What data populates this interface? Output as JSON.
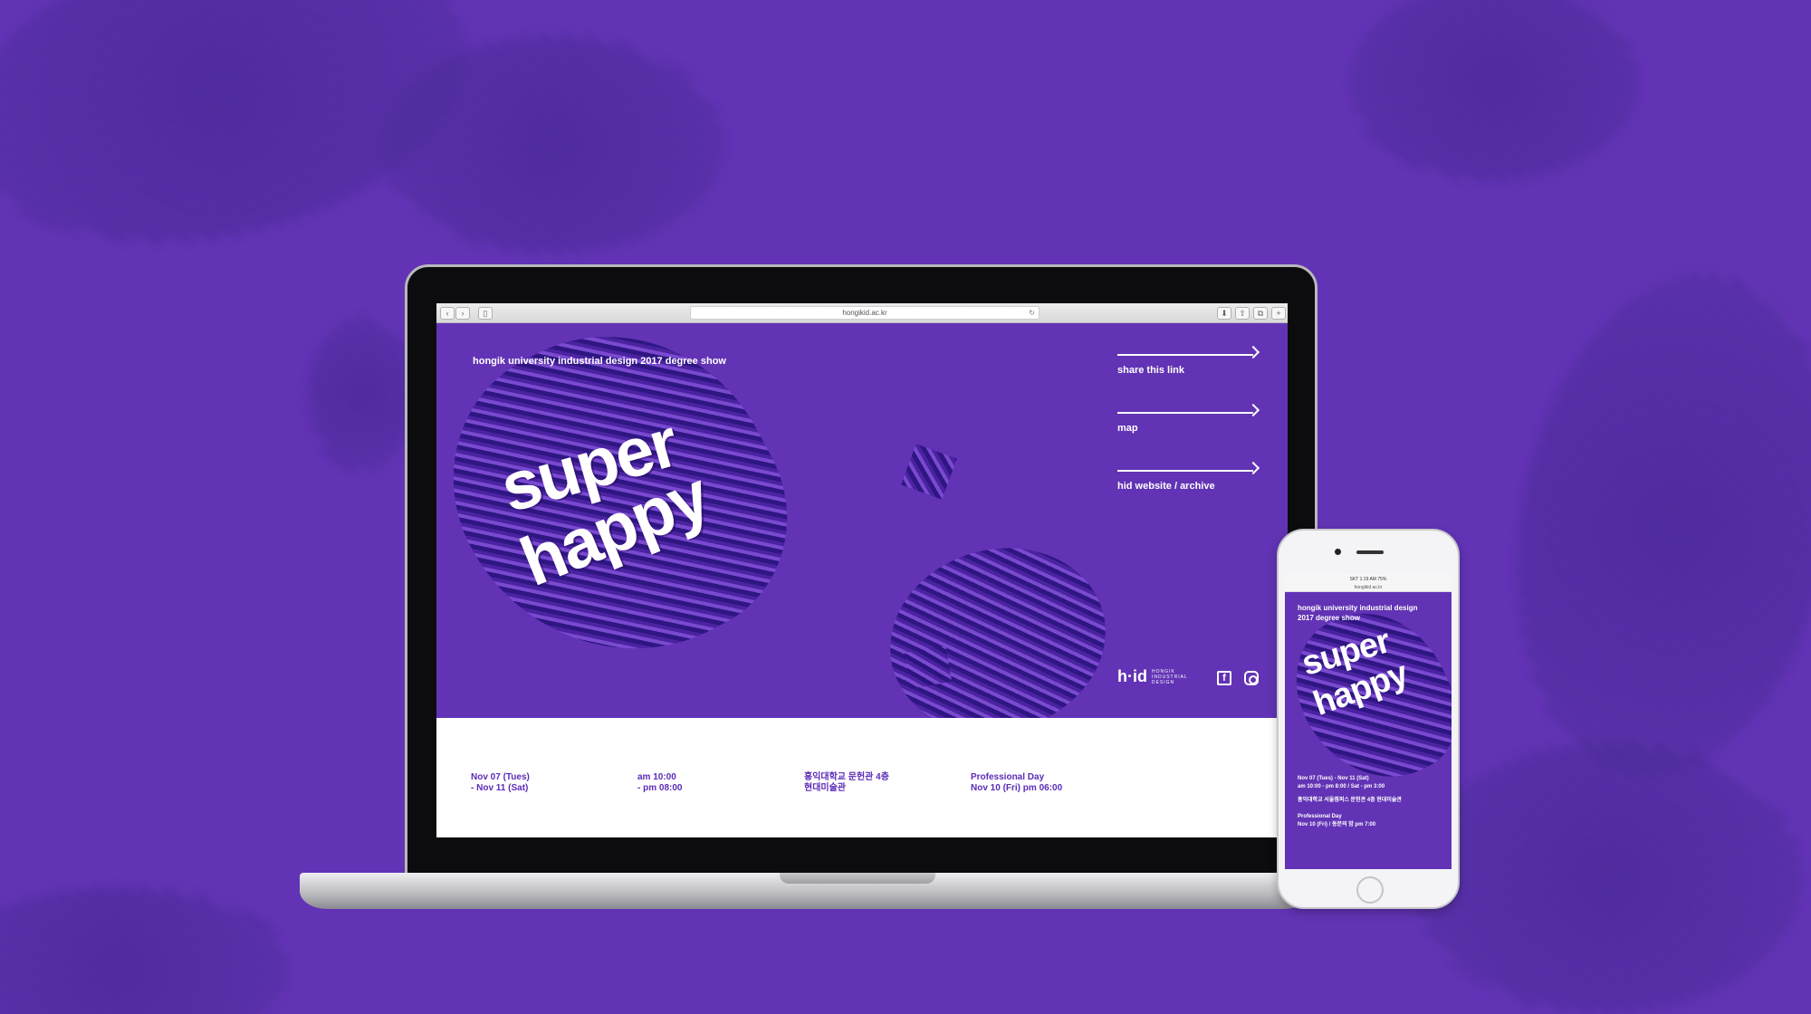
{
  "browser": {
    "url": "hongikid.ac.kr",
    "back_icon": "chevron-left-icon",
    "forward_icon": "chevron-right-icon",
    "sidebar_icon": "sidebar-icon",
    "reload_icon": "reload-icon",
    "download_icon": "download-icon",
    "share_icon": "share-icon",
    "tabs_icon": "tabs-icon",
    "new_tab_icon": "plus-icon",
    "back_glyph": "‹",
    "forward_glyph": "›",
    "sidebar_glyph": "▯",
    "reload_glyph": "↻",
    "download_glyph": "⬇",
    "share_glyph": "⇧",
    "tabs_glyph": "⧉",
    "new_tab_glyph": "+"
  },
  "hero": {
    "title": "hongik university industrial design 2017 degree show",
    "word_super": "super",
    "word_happy": "happy"
  },
  "links": [
    {
      "label": "share this link"
    },
    {
      "label": "map"
    },
    {
      "label": "hid website / archive"
    }
  ],
  "brand": {
    "logo": "h·id",
    "sub_line1": "HONGIK",
    "sub_line2": "INDUSTRIAL",
    "sub_line3": "DESIGN",
    "facebook_glyph": "f"
  },
  "info": {
    "dates_line1": "Nov 07 (Tues)",
    "dates_line2": "- Nov 11 (Sat)",
    "time_line1": "am 10:00",
    "time_line2": "- pm 08:00",
    "place_line1": "홍익대학교 문헌관 4층",
    "place_line2": "현대미술관",
    "pro_line1": "Professional Day",
    "pro_line2": "Nov 10 (Fri) pm 06:00"
  },
  "phone": {
    "status": "SKT   1:19 AM   75%",
    "url": "hongikid.ac.kr",
    "title": "hongik university industrial design 2017 degree show",
    "word_super": "super",
    "word_happy": "happy",
    "info_dates": "Nov 07 (Tues) - Nov 11 (Sat)",
    "info_time": "am 10:00 - pm 8:00 / Sat - pm 3:00",
    "info_place": "홍익대학교 서울캠퍼스 문헌관 4층 현대미술관",
    "info_pro1": "Professional Day",
    "info_pro2": "Nov 10 (Fri) / 동문의 밤 pm 7:00"
  },
  "colors": {
    "brand_purple": "#6233b5",
    "info_text": "#5b2bb8"
  }
}
